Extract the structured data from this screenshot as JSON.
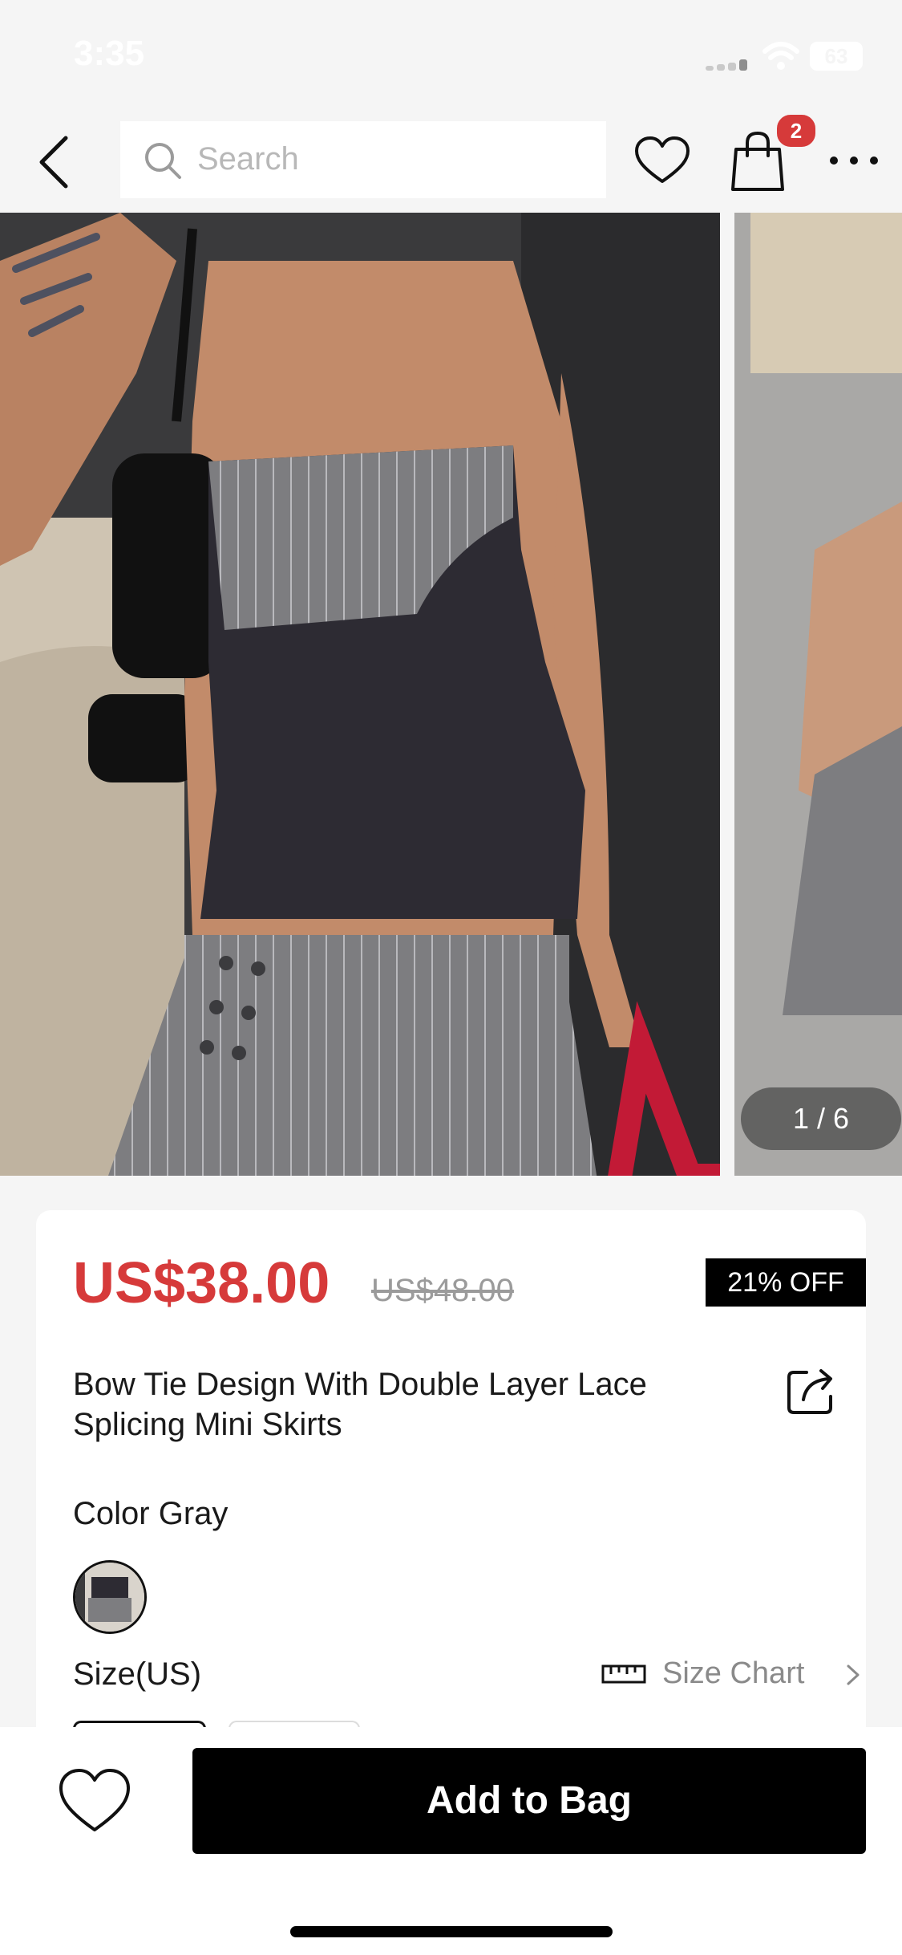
{
  "status_bar": {
    "time": "3:35",
    "battery": "63"
  },
  "nav": {
    "search_placeholder": "Search",
    "cart_count": "2",
    "icons": [
      "back-icon",
      "search-icon",
      "heart-icon",
      "shopping-bag-icon",
      "more-icon"
    ]
  },
  "gallery": {
    "indicator": "1 / 6",
    "current": 1,
    "total": 6
  },
  "product": {
    "price": "US$38.00",
    "original_price": "US$48.00",
    "discount": "21% OFF",
    "title": "Bow Tie Design With Double Layer Lace Splicing Mini Skirts",
    "color_label": "Color Gray",
    "size_label": "Size(US)",
    "size_chart_label": "Size Chart"
  },
  "footer": {
    "add_to_bag": "Add to Bag"
  },
  "colors": {
    "accent_red": "#d63a3a",
    "primary_black": "#000000",
    "background": "#f5f5f5"
  }
}
